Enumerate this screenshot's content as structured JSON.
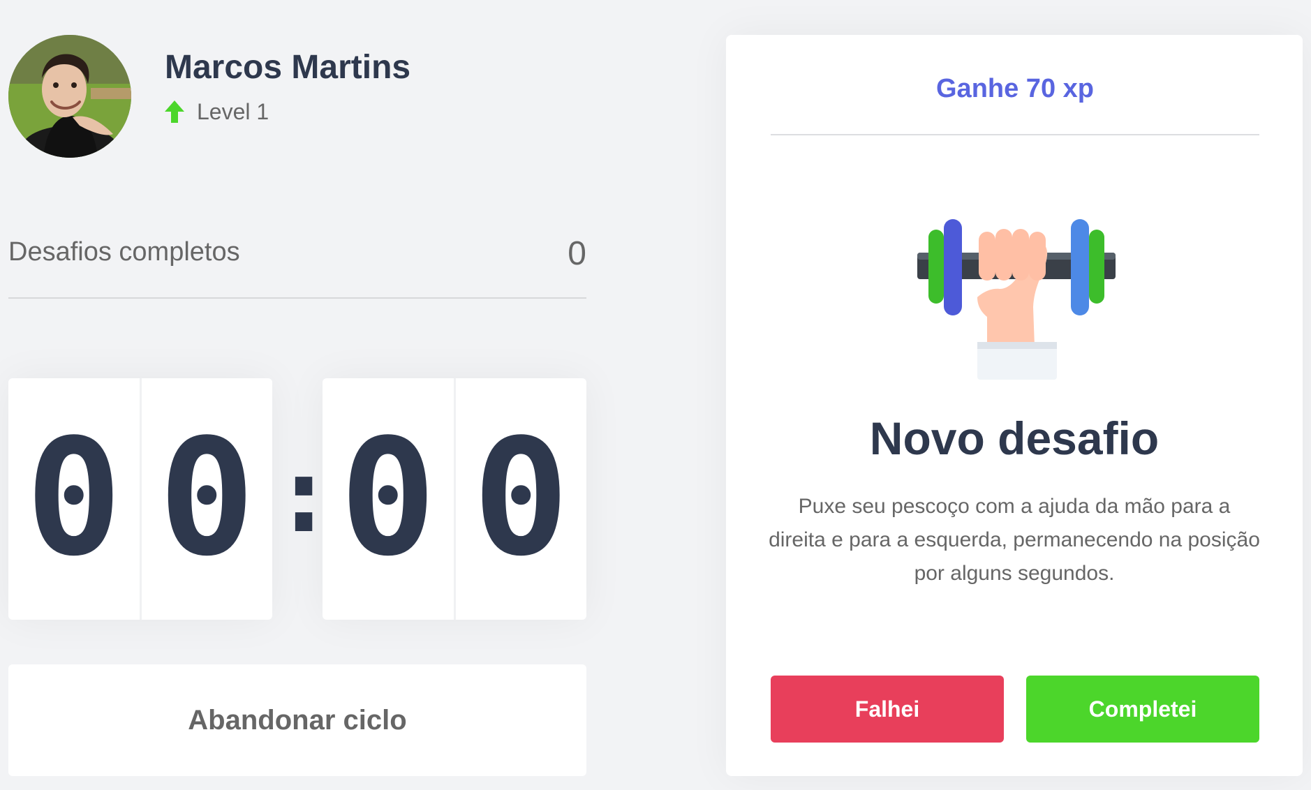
{
  "profile": {
    "name": "Marcos Martins",
    "level": "Level 1"
  },
  "stats": {
    "challenges_label": "Desafios completos",
    "challenges_count": "0"
  },
  "countdown": {
    "minute_left": "0",
    "minute_right": "0",
    "separator": ":",
    "second_left": "0",
    "second_right": "0"
  },
  "actions": {
    "abandon_label": "Abandonar ciclo"
  },
  "challenge": {
    "header": "Ganhe 70 xp",
    "title": "Novo desafio",
    "description": "Puxe seu pescoço com a ajuda da mão para a direita e para a esquerda, permanecendo na posição por alguns segundos.",
    "fail_label": "Falhei",
    "success_label": "Completei"
  },
  "colors": {
    "background": "#f2f3f5",
    "title": "#2e384d",
    "text": "#666666",
    "accent_blue": "#5965e0",
    "fail_red": "#e83f5b",
    "success_green": "#4cd62b"
  },
  "icons": {
    "level": "level-up-arrow-icon",
    "challenge": "dumbbell-hand-icon"
  }
}
